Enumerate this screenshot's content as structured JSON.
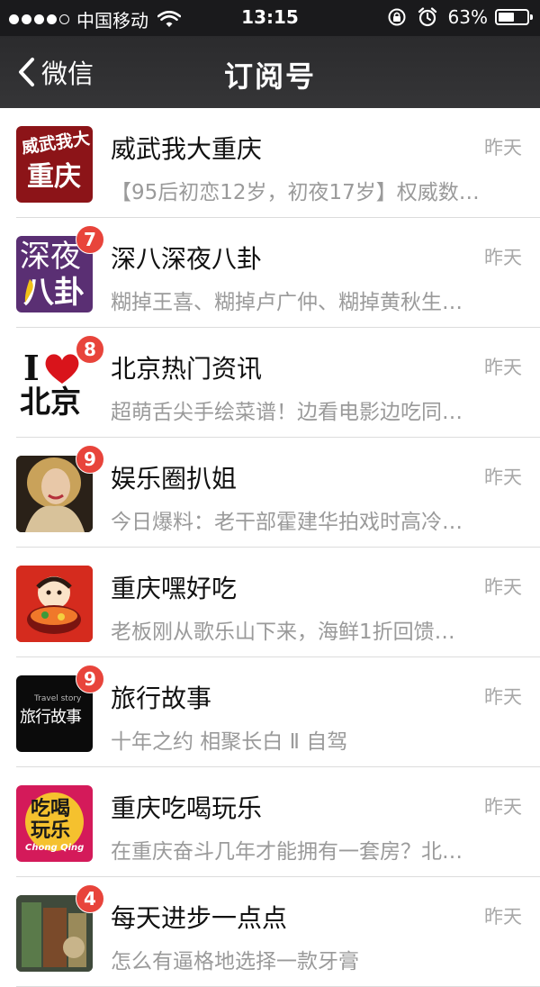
{
  "status_bar": {
    "carrier": "中国移动",
    "time": "13:15",
    "battery_percent_label": "63%",
    "battery_level": 0.63,
    "signal_bars_filled": 4,
    "signal_bars_total": 5,
    "icons": [
      "wifi-icon",
      "rotation-lock-icon",
      "alarm-icon",
      "battery-icon"
    ]
  },
  "nav": {
    "back_label": "微信",
    "title": "订阅号"
  },
  "items": [
    {
      "name": "威武我大重庆",
      "time": "昨天",
      "preview": "【95后初恋12岁，初夜17岁】权威数…",
      "badge": "",
      "avatar_text": [
        "威武我大",
        "重庆"
      ],
      "avatar_bg": "#8c1418"
    },
    {
      "name": "深八深夜八卦",
      "time": "昨天",
      "preview": "糊掉王喜、糊掉卢广仲、糊掉黄秋生…",
      "badge": "7",
      "avatar_text": [
        "深夜",
        "八卦"
      ],
      "avatar_bg": "#5a2f73"
    },
    {
      "name": "北京热门资讯",
      "time": "昨天",
      "preview": "超萌舌尖手绘菜谱！边看电影边吃同…",
      "badge": "8",
      "avatar_text": [
        "I",
        "北京"
      ],
      "avatar_bg": "#ffffff"
    },
    {
      "name": "娱乐圈扒姐",
      "time": "昨天",
      "preview": "今日爆料：老干部霍建华拍戏时高冷…",
      "badge": "9",
      "avatar_text": [],
      "avatar_bg": "#2a2118"
    },
    {
      "name": "重庆嘿好吃",
      "time": "昨天",
      "preview": "老板刚从歌乐山下来，海鲜1折回馈…",
      "badge": "",
      "avatar_text": [],
      "avatar_bg": "#d52b1e"
    },
    {
      "name": "旅行故事",
      "time": "昨天",
      "preview": "十年之约 相聚长白 Ⅱ 自驾",
      "badge": "9",
      "avatar_text": [
        "Travel story",
        "旅行故事"
      ],
      "avatar_bg": "#0b0b0b"
    },
    {
      "name": "重庆吃喝玩乐",
      "time": "昨天",
      "preview": "在重庆奋斗几年才能拥有一套房？北…",
      "badge": "",
      "avatar_text": [
        "吃喝",
        "玩乐",
        "Chong Qing"
      ],
      "avatar_bg": "#d41a5a"
    },
    {
      "name": "每天进步一点点",
      "time": "昨天",
      "preview": "怎么有逼格地选择一款牙膏",
      "badge": "4",
      "avatar_text": [],
      "avatar_bg": "#3f4a3b"
    }
  ]
}
